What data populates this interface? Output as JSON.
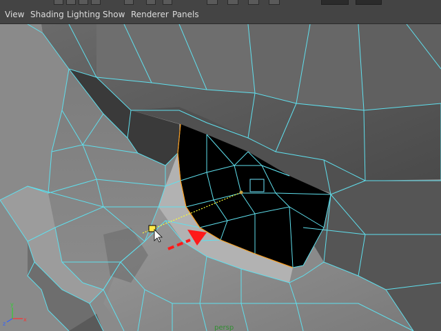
{
  "menu": {
    "view": "View",
    "shading": "Shading",
    "lighting": "Lighting",
    "show": "Show",
    "renderer": "Renderer",
    "panels": "Panels"
  },
  "viewport": {
    "camera_label": "persp",
    "axis_labels": {
      "x": "x",
      "y": "y",
      "z": "z"
    },
    "colors": {
      "wire": "#5fe0ee",
      "background": "#8a8a8a",
      "highlight_edge": "#ff9a1a",
      "arrow": "#ff1a1a",
      "dotted_line": "#ffff33",
      "selection_handle": "#ffe84a",
      "camera_label": "#2f8f2f"
    }
  },
  "icons": {
    "cursor": "arrow-cursor-icon",
    "axis": "axis-gizmo-icon",
    "manipulator": "square-manipulator-icon",
    "direction": "red-arrow-icon"
  }
}
